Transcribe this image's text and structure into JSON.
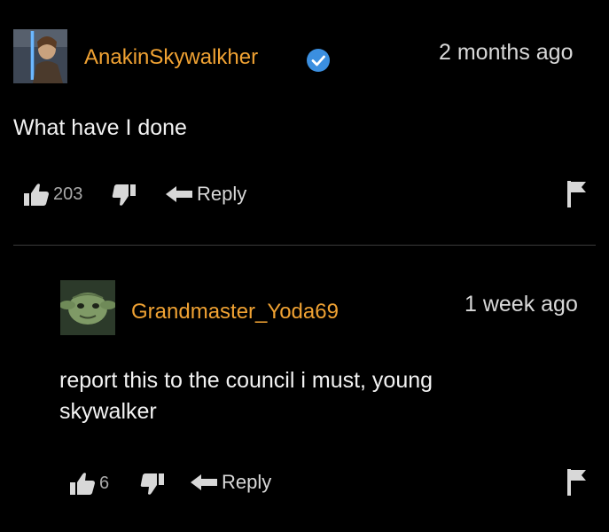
{
  "colors": {
    "background": "#000000",
    "username": "#f0a233",
    "text": "#f2f2f2",
    "meta": "#d8d8d8",
    "verified_badge": "#3b8fe0"
  },
  "comment": {
    "username": "AnakinSkywalkher",
    "verified": true,
    "timestamp": "2 months ago",
    "text": "What have I done",
    "like_count": "203",
    "reply_label": "Reply",
    "icons": [
      "thumbs-up-icon",
      "thumbs-down-icon",
      "reply-arrow-icon",
      "flag-icon",
      "verified-check-icon"
    ]
  },
  "reply": {
    "username": "Grandmaster_Yoda69",
    "timestamp": "1 week ago",
    "text": "report this to the council i must, young skywalker",
    "like_count": "6",
    "reply_label": "Reply"
  }
}
